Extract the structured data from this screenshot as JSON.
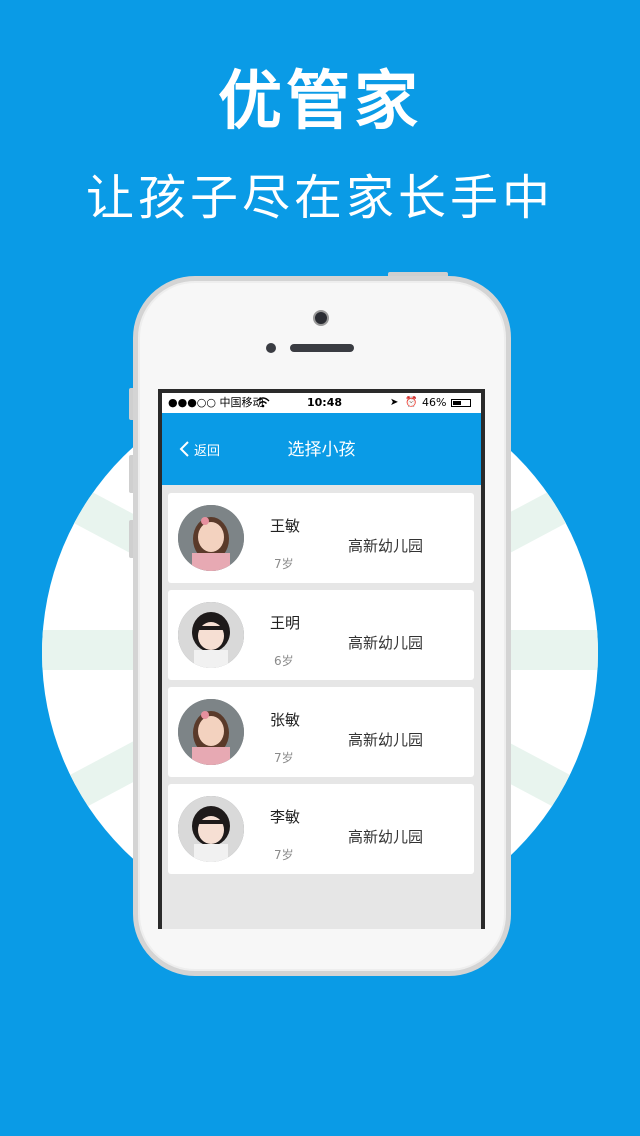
{
  "header": {
    "title": "优管家",
    "subtitle": "让孩子尽在家长手中"
  },
  "status_bar": {
    "carrier": "●●●○○ 中国移动",
    "time": "10:48",
    "battery": "46%"
  },
  "nav": {
    "back_label": "返回",
    "title": "选择小孩"
  },
  "children": [
    {
      "name": "王敏",
      "age": "7岁",
      "school": "高新幼儿园"
    },
    {
      "name": "王明",
      "age": "6岁",
      "school": "高新幼儿园"
    },
    {
      "name": "张敏",
      "age": "7岁",
      "school": "高新幼儿园"
    },
    {
      "name": "李敏",
      "age": "7岁",
      "school": "高新幼儿园"
    }
  ],
  "colors": {
    "brand_blue": "#0a9be6",
    "card_bg": "#ffffff",
    "list_bg": "#e6e6e6"
  }
}
